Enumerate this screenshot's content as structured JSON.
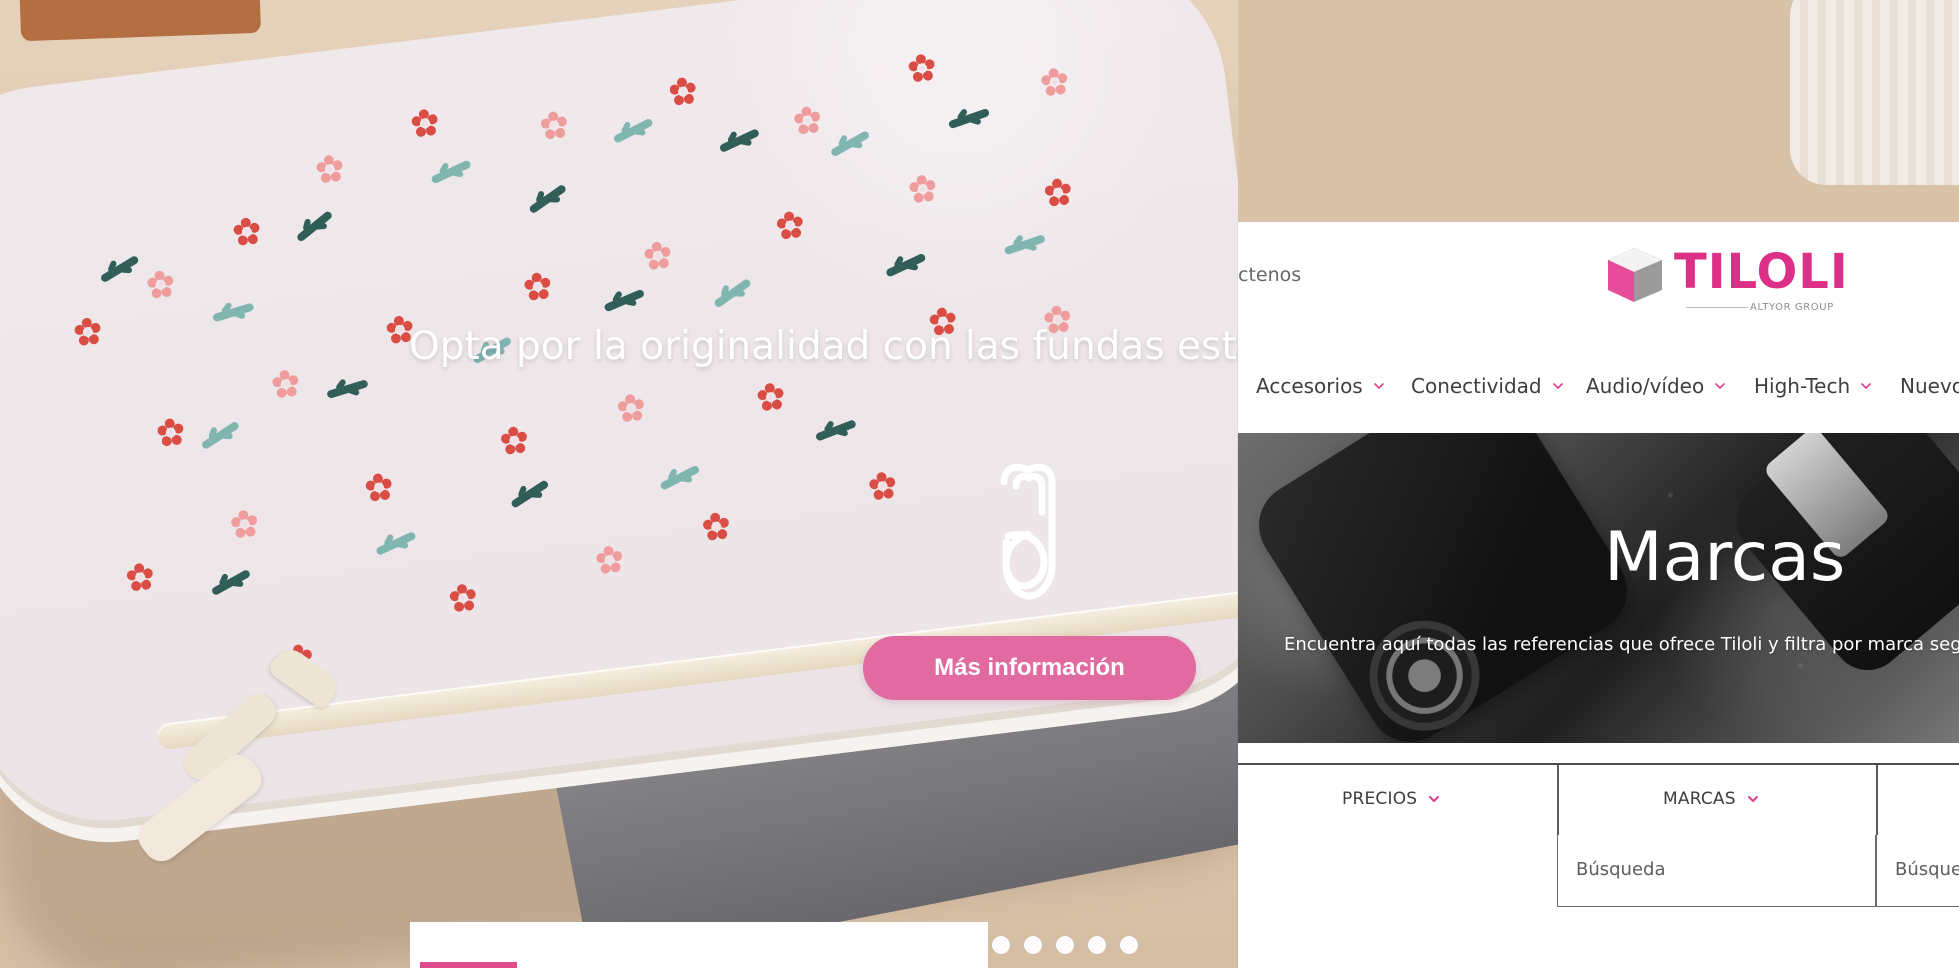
{
  "hero": {
    "headline": "Opta por la originalidad con las fundas esta",
    "cta_label": "Más información"
  },
  "site": {
    "contact_label": "ctenos",
    "brand_name": "TILOLI",
    "brand_subtitle": "ALTYOR GROUP",
    "brand_color": "#dc2f88"
  },
  "navigation": {
    "items": [
      {
        "label": "Accesorios"
      },
      {
        "label": "Conectividad"
      },
      {
        "label": "Audio/vídeo"
      },
      {
        "label": "High-Tech"
      },
      {
        "label": "Nuevo"
      }
    ]
  },
  "banner": {
    "title": "Marcas",
    "description": "Encuentra aquí todas las referencias que ofrece Tiloli y filtra por marca seg"
  },
  "filters": {
    "items": [
      {
        "label": "PRECIOS"
      },
      {
        "label": "MARCAS"
      }
    ]
  },
  "search": {
    "items": [
      {
        "label": "Búsqueda"
      },
      {
        "label": "Búsque"
      }
    ]
  },
  "slider": {
    "dot_count": 5
  },
  "colors": {
    "accent_pink": "#e16aa0",
    "nav_arrow_pink": "#df3f8f",
    "text_dark": "#3f3f3f",
    "text_muted": "#676767"
  },
  "icons": {
    "nav_arrow": "chevron-down-icon",
    "filter_arrow": "chevron-down-icon",
    "hero_logo": "monogram-logo-icon",
    "brand_logo": "tiloli-logo-icon"
  }
}
